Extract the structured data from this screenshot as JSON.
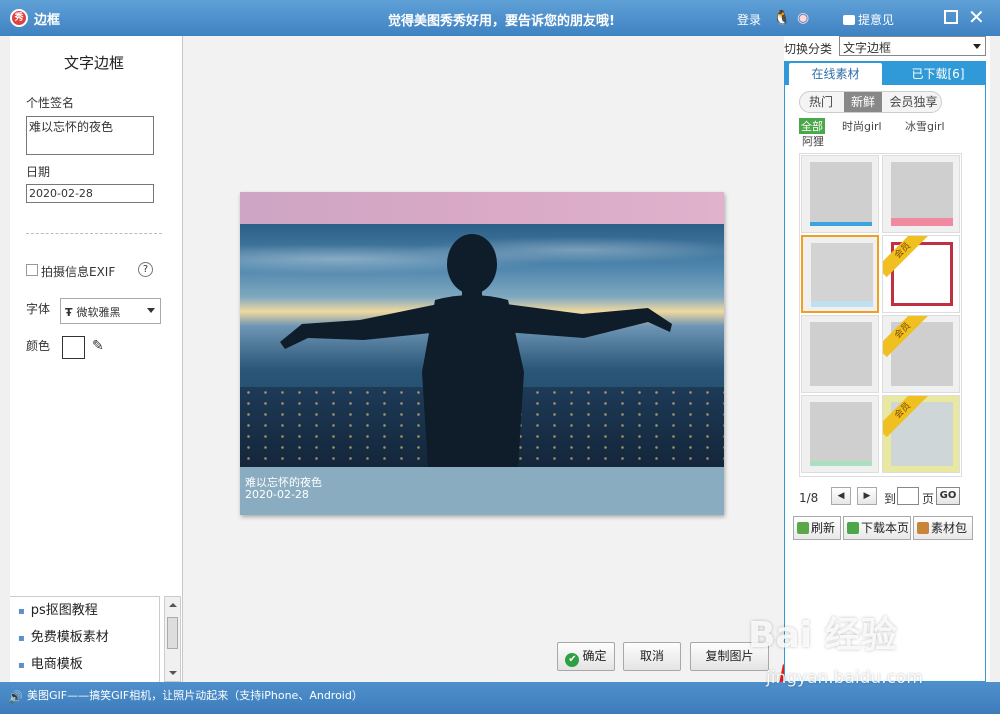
{
  "titlebar": {
    "logo": "秀",
    "title": "边框",
    "slogan": "觉得美图秀秀好用，要告诉您的朋友哦!",
    "login": "登录",
    "feedback": "提意见"
  },
  "left": {
    "title": "文字边框",
    "signature_label": "个性签名",
    "signature_value": "难以忘怀的夜色",
    "date_label": "日期",
    "date_value": "2020-02-28",
    "exif_label": "拍摄信息EXIF",
    "help": "?",
    "font_label": "字体",
    "font_value": "微软雅黑",
    "color_label": "颜色",
    "links": [
      "ps抠图教程",
      "免费模板素材",
      "电商模板"
    ]
  },
  "photo": {
    "caption_line1": "难以忘怀的夜色",
    "caption_line2": "2020-02-28"
  },
  "buttons": {
    "ok": "确定",
    "cancel": "取消",
    "copy": "复制图片"
  },
  "right": {
    "category_label": "切换分类",
    "category_value": "文字边框",
    "tab_online": "在线素材",
    "tab_downloaded": "已下载[6]",
    "subtabs": [
      "热门",
      "新鲜",
      "会员独享"
    ],
    "tags": [
      "全部",
      "时尚girl",
      "冰雪girl",
      "阿狸"
    ],
    "vip_badge": "会员",
    "page": "1/8",
    "to_label": "到",
    "page_label": "页",
    "go": "GO",
    "refresh": "刷新",
    "download_page": "下载本页",
    "material_pack": "素材包"
  },
  "status": {
    "text": "美图GIF——搞笑GIF相机，让照片动起来（支持iPhone、Android）"
  },
  "watermark": {
    "line1": "Bai 经验",
    "line2": "jingyan.baidu.com"
  },
  "colors": {
    "titlebar": "#4a8fcf",
    "tab_accent": "#2f9ad7",
    "ok_check": "#2ea043",
    "selected_thumb": "#f0a020",
    "arrow": "#e02020"
  }
}
